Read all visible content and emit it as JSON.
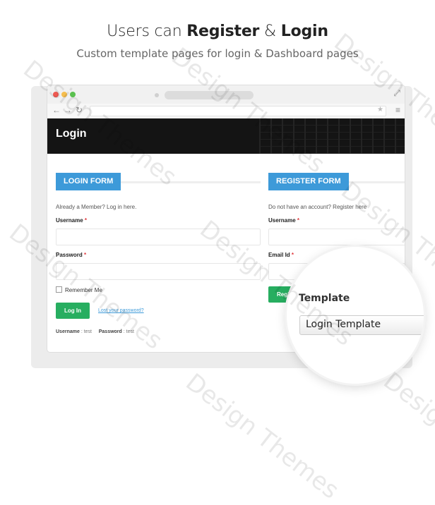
{
  "headline": {
    "prefix": "Users can ",
    "register": "Register",
    "amp": " & ",
    "login": "Login"
  },
  "subhead": "Custom template pages for login & Dashboard pages",
  "watermark_text": "Design Themes",
  "browser": {
    "page_title": "Login"
  },
  "login_form": {
    "tag": "LOGIN FORM",
    "intro": "Already a Member? Log in here.",
    "username_label": "Username",
    "password_label": "Password",
    "required_mark": "*",
    "remember_label": "Remember Me",
    "login_button": "Log In",
    "lost_password": "Lost your password?",
    "creds_username_label": "Username",
    "creds_username_value": ": test",
    "creds_password_label": "Password",
    "creds_password_value": ": test"
  },
  "register_form": {
    "tag": "REGISTER FORM",
    "intro": "Do not have an account? Register here",
    "username_label": "Username",
    "email_label": "Email Id",
    "required_mark": "*",
    "register_button": "Regi"
  },
  "magnifier": {
    "label": "Template",
    "select_value": "Login Template"
  },
  "colors": {
    "accent": "#3d9ad9",
    "button": "#27ae60",
    "hero": "#141414"
  }
}
